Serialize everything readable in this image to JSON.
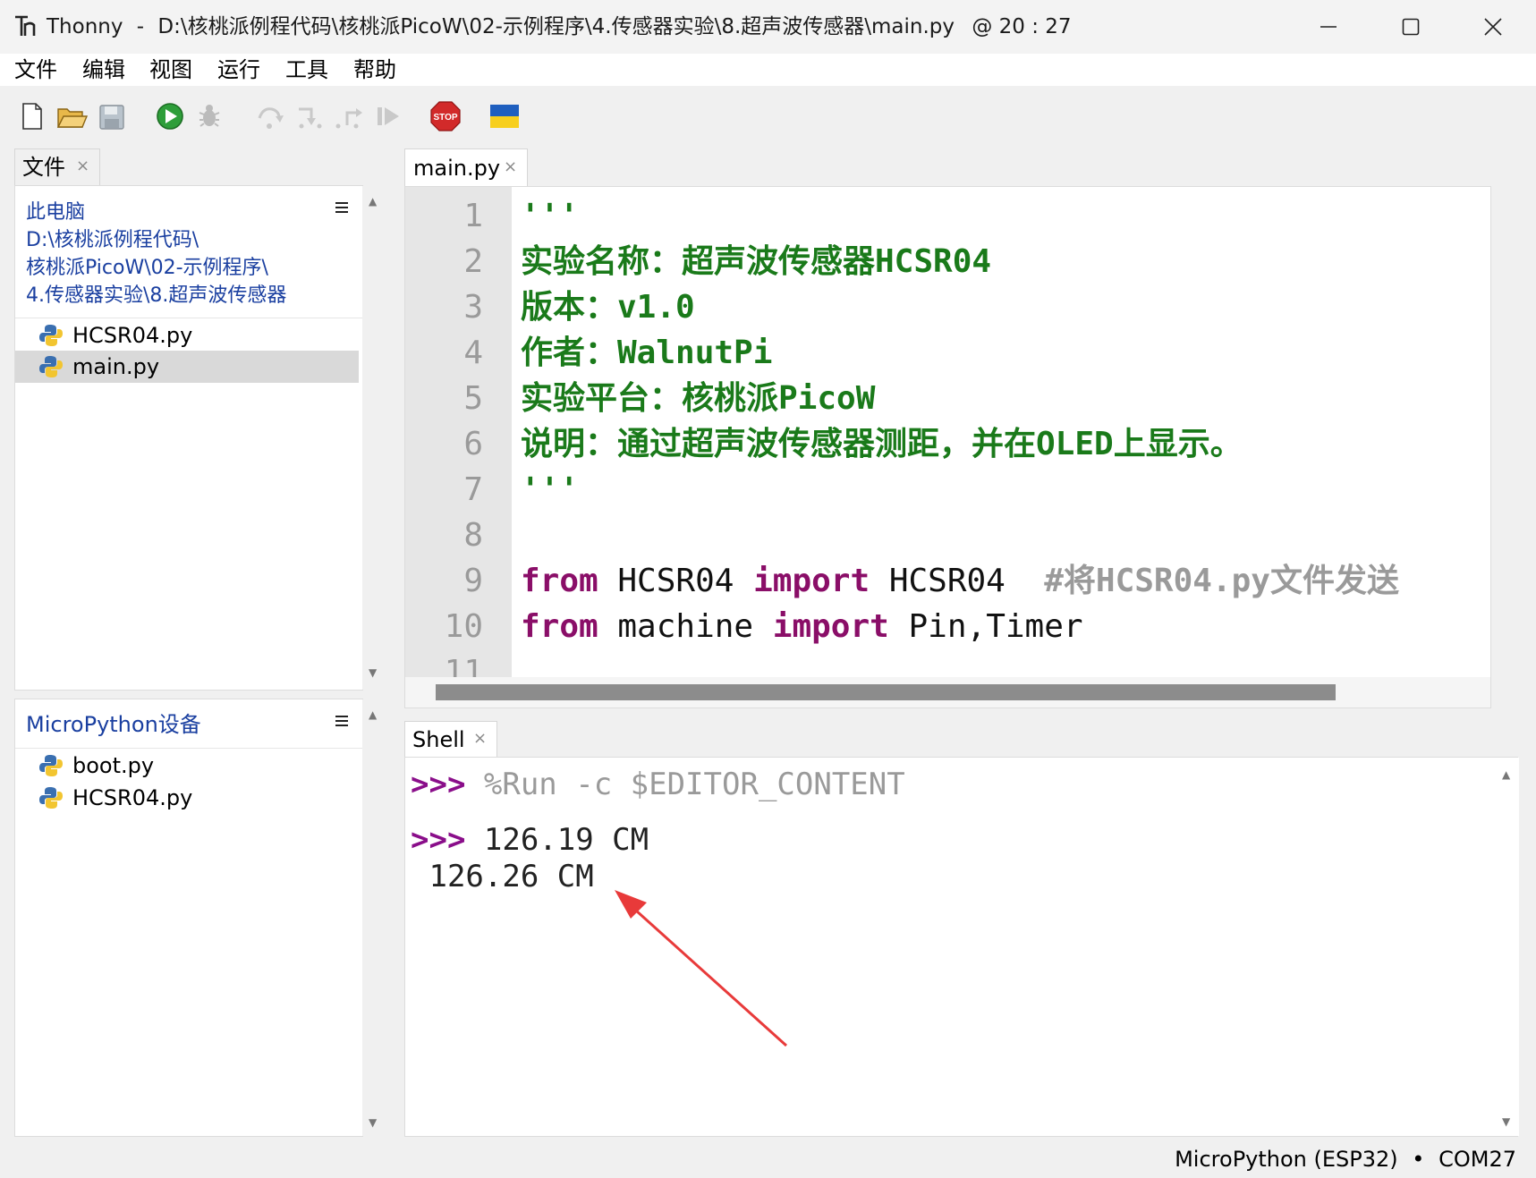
{
  "window": {
    "app_name": "Thonny",
    "separator": "-",
    "path": "D:\\核桃派例程代码\\核桃派PicoW\\02-示例程序\\4.传感器实验\\8.超声波传感器\\main.py",
    "cursor": "@  20 : 27"
  },
  "menu": [
    "文件",
    "编辑",
    "视图",
    "运行",
    "工具",
    "帮助"
  ],
  "toolbar": {
    "icons": [
      "new-file-icon",
      "open-file-icon",
      "save-icon",
      "run-icon",
      "debug-icon",
      "step-over-icon",
      "step-into-icon",
      "step-out-icon",
      "resume-icon",
      "stop-icon",
      "ukraine-flag-icon"
    ],
    "stop_label": "STOP"
  },
  "files_pane": {
    "tab_label": "文件",
    "local": {
      "title": "此电脑",
      "path_lines": [
        "D:\\核桃派例程代码\\",
        "核桃派PicoW\\02-示例程序\\",
        "4.传感器实验\\8.超声波传感器"
      ],
      "files": [
        "HCSR04.py",
        "main.py"
      ],
      "selected": "main.py"
    },
    "device": {
      "title": "MicroPython设备",
      "files": [
        "boot.py",
        "HCSR04.py"
      ]
    }
  },
  "editor": {
    "tab_label": "main.py",
    "line_numbers": [
      "1",
      "2",
      "3",
      "4",
      "5",
      "6",
      "7",
      "8",
      "9",
      "10",
      "11"
    ],
    "lines": {
      "l1": "'''",
      "l2": "实验名称：超声波传感器HCSR04",
      "l3": "版本：v1.0",
      "l4": "作者：WalnutPi",
      "l5": "实验平台：核桃派PicoW",
      "l6": "说明：通过超声波传感器测距，并在OLED上显示。",
      "l7": "'''",
      "l9_kw1": "from",
      "l9_mod": " HCSR04 ",
      "l9_kw2": "import",
      "l9_name": " HCSR04  ",
      "l9_comment": "#将HCSR04.py文件发送",
      "l10_kw1": "from",
      "l10_mod": " machine ",
      "l10_kw2": "import",
      "l10_name": " Pin,Timer"
    }
  },
  "shell": {
    "tab_label": "Shell",
    "prompt": ">>>",
    "command": " %Run -c $EDITOR_CONTENT",
    "output_1": " 126.19 CM",
    "output_2": " 126.26 CM"
  },
  "status": {
    "interpreter": "MicroPython (ESP32)",
    "dot": "•",
    "port": "COM27"
  },
  "colors": {
    "string_green": "#1a7a1a",
    "keyword_purple": "#8a0e68",
    "prompt_purple": "#8a0e8a",
    "path_blue": "#1a3fa0",
    "annotation_arrow": "#e83a3a"
  }
}
